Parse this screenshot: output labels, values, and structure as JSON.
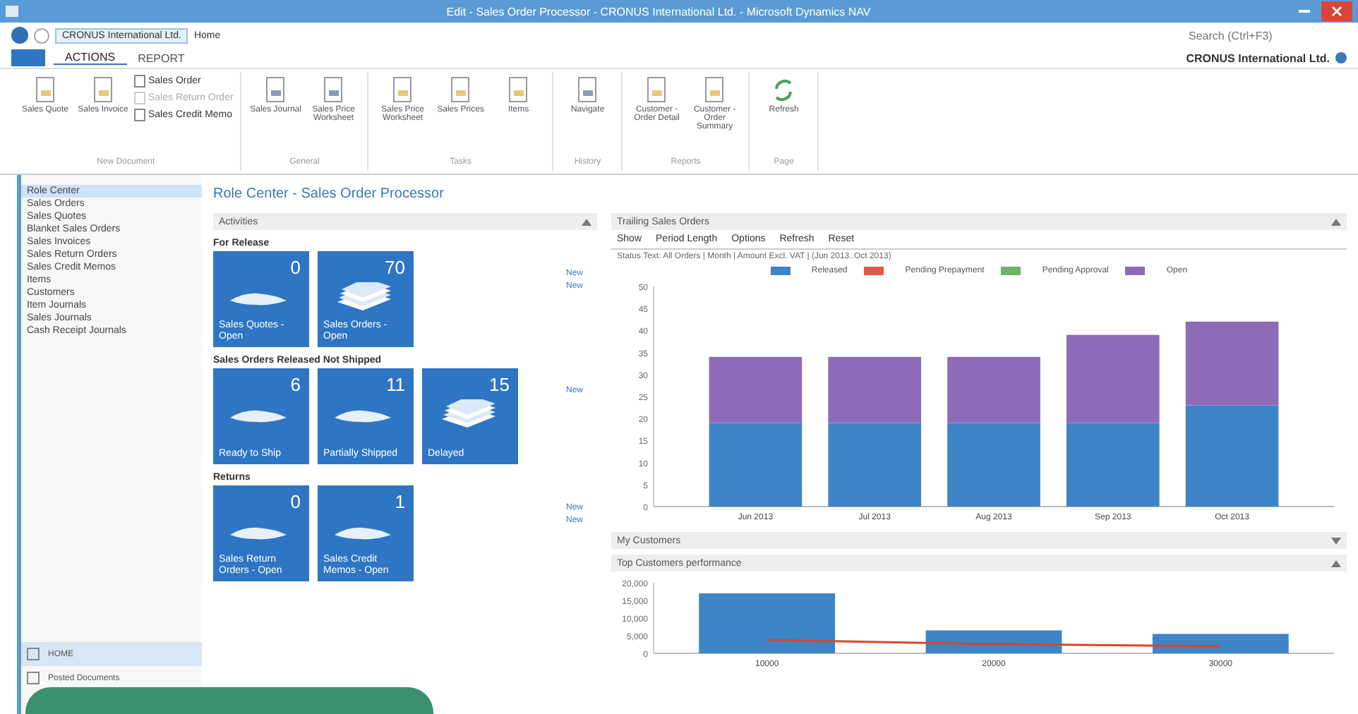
{
  "window": {
    "title": "Edit - Sales Order Processor - CRONUS International Ltd. - Microsoft Dynamics NAV"
  },
  "address_bar": {
    "path": "CRONUS International Ltd.",
    "location": "Home"
  },
  "search": {
    "placeholder": "Search (Ctrl+F3)"
  },
  "company": "CRONUS International Ltd.",
  "ribbon": {
    "tabs": [
      {
        "label": "ACTIONS",
        "selected": true
      },
      {
        "label": "REPORT",
        "selected": false
      }
    ],
    "groups": [
      {
        "label": "New Document",
        "items": [
          {
            "label": "Sales Quote",
            "kind": "large",
            "disabled": false
          },
          {
            "label": "Sales Invoice",
            "kind": "large",
            "disabled": false
          },
          {
            "label": "Sales Order",
            "kind": "small",
            "disabled": false
          },
          {
            "label": "Sales Return Order",
            "kind": "small",
            "disabled": true
          },
          {
            "label": "Sales Credit Memo",
            "kind": "small",
            "disabled": false
          }
        ]
      },
      {
        "label": "General",
        "items": [
          {
            "label": "Sales Journal",
            "kind": "large",
            "disabled": false
          },
          {
            "label": "Sales Price Worksheet",
            "kind": "large",
            "disabled": false
          }
        ]
      },
      {
        "label": "Tasks",
        "items": [
          {
            "label": "Sales Price Worksheet",
            "kind": "large",
            "disabled": false
          },
          {
            "label": "Sales Prices",
            "kind": "large",
            "disabled": false
          },
          {
            "label": "Items",
            "kind": "large",
            "disabled": false
          }
        ]
      },
      {
        "label": "History",
        "items": [
          {
            "label": "Navigate",
            "kind": "large",
            "disabled": false
          }
        ]
      },
      {
        "label": "Reports",
        "items": [
          {
            "label": "Customer - Order Detail",
            "kind": "large",
            "disabled": false
          },
          {
            "label": "Customer - Order Summary",
            "kind": "large",
            "disabled": false
          }
        ]
      },
      {
        "label": "Page",
        "items": [
          {
            "label": "Refresh",
            "kind": "refresh",
            "disabled": false
          }
        ]
      }
    ]
  },
  "navigation": {
    "items": [
      {
        "label": "Role Center",
        "selected": true
      },
      {
        "label": "Sales Orders",
        "selected": false
      },
      {
        "label": "Sales Quotes",
        "selected": false
      },
      {
        "label": "Blanket Sales Orders",
        "selected": false
      },
      {
        "label": "Sales Invoices",
        "selected": false
      },
      {
        "label": "Sales Return Orders",
        "selected": false
      },
      {
        "label": "Sales Credit Memos",
        "selected": false
      },
      {
        "label": "Items",
        "selected": false
      },
      {
        "label": "Customers",
        "selected": false
      },
      {
        "label": "Item Journals",
        "selected": false
      },
      {
        "label": "Sales Journals",
        "selected": false
      },
      {
        "label": "Cash Receipt Journals",
        "selected": false
      }
    ],
    "departments": [
      {
        "label": "HOME",
        "selected": true
      },
      {
        "label": "Posted Documents",
        "selected": false
      }
    ]
  },
  "page_title": "Role Center - Sales Order Processor",
  "activities": {
    "title": "Activities",
    "groups": [
      {
        "label": "For Release",
        "links": [
          "New",
          "New"
        ],
        "tiles": [
          {
            "count": "0",
            "caption": "Sales Quotes - Open",
            "kind": "single"
          },
          {
            "count": "70",
            "caption": "Sales Orders - Open",
            "kind": "stack"
          }
        ]
      },
      {
        "label": "Sales Orders Released Not Shipped",
        "links": [
          "New"
        ],
        "tiles": [
          {
            "count": "6",
            "caption": "Ready to Ship",
            "kind": "single"
          },
          {
            "count": "11",
            "caption": "Partially Shipped",
            "kind": "single"
          },
          {
            "count": "15",
            "caption": "Delayed",
            "kind": "stack"
          }
        ]
      },
      {
        "label": "Returns",
        "links": [
          "New",
          "New"
        ],
        "tiles": [
          {
            "count": "0",
            "caption": "Sales Return Orders - Open",
            "kind": "single"
          },
          {
            "count": "1",
            "caption": "Sales Credit Memos - Open",
            "kind": "single"
          }
        ]
      }
    ]
  },
  "trailing_orders": {
    "title": "Trailing Sales Orders",
    "toolbar": [
      "Show",
      "Period Length",
      "Options",
      "Refresh",
      "Reset"
    ],
    "status": "Status Text: All Orders | Month | Amount Excl. VAT | (Jun 2013..Oct 2013)",
    "chart_data": {
      "type": "bar",
      "stacked": true,
      "categories": [
        "Jun 2013",
        "Jul 2013",
        "Aug 2013",
        "Sep 2013",
        "Oct 2013"
      ],
      "series": [
        {
          "name": "Released",
          "color": "#3d85c6",
          "values": [
            19,
            19,
            19,
            19,
            23
          ]
        },
        {
          "name": "Pending Prepayment",
          "color": "#e0584a",
          "values": [
            0,
            0,
            0,
            0,
            0
          ]
        },
        {
          "name": "Pending Approval",
          "color": "#6bb36b",
          "values": [
            0,
            0,
            0,
            0,
            0
          ]
        },
        {
          "name": "Open",
          "color": "#8e6bb8",
          "values": [
            15,
            15,
            15,
            20,
            19
          ]
        }
      ],
      "ylim": [
        0,
        50
      ],
      "yticks": [
        0,
        5,
        10,
        15,
        20,
        25,
        30,
        35,
        40,
        45,
        50
      ]
    }
  },
  "collapsed_parts": [
    {
      "title": "My Customers",
      "expanded": false
    },
    {
      "title": "Top Customers performance",
      "expanded": true
    }
  ],
  "performance_chart": {
    "chart_data": {
      "type": "bar",
      "categories": [
        "10000",
        "20000",
        "30000"
      ],
      "series": [
        {
          "color": "#3d85c6",
          "values": [
            17000,
            6500,
            5500
          ]
        },
        {
          "color": "#d9452f",
          "values": [
            3800,
            2600,
            2000
          ],
          "type": "line"
        }
      ],
      "ylim": [
        0,
        20000
      ],
      "yticks": [
        {
          "value": 0,
          "label": "0"
        },
        {
          "value": 5000,
          "label": "5,000"
        },
        {
          "value": 10000,
          "label": "10,000"
        },
        {
          "value": 15000,
          "label": "15,000"
        },
        {
          "value": 20000,
          "label": "20,000"
        }
      ]
    }
  }
}
